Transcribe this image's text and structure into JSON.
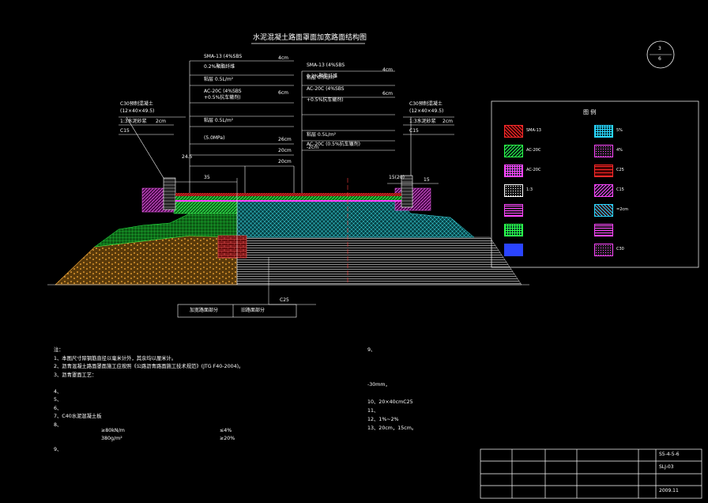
{
  "drawing": {
    "title": "水泥混凝土路面罩面加宽路面结构图",
    "sheet_top": "3",
    "sheet_bottom": "6"
  },
  "layers_center": [
    {
      "label": "SMA-13 (4%SBS",
      "thick": "4cm"
    },
    {
      "label": "0.2%聚酯纤维",
      "thick": ""
    },
    {
      "label": "粘层 0.5L/m²",
      "thick": ""
    },
    {
      "label": "AC-20C (4%SBS",
      "thick": "6cm"
    },
    {
      "label": "+0.5%抗车辙剂)",
      "thick": ""
    },
    {
      "label": "粘层 0.5L/m²",
      "thick": ""
    },
    {
      "label": "(5.0MPa)",
      "thick": "26cm"
    },
    {
      "label": "",
      "thick": "20cm"
    },
    {
      "label": "",
      "thick": "20cm"
    }
  ],
  "layers_right": [
    {
      "label": "SMA-13 (4%SBS",
      "thick": "4cm"
    },
    {
      "label": "0.2%聚酯纤维",
      "thick": ""
    },
    {
      "label": "粘层 0.5L/m²",
      "thick": ""
    },
    {
      "label": "AC-20C (4%SBS",
      "thick": "6cm"
    },
    {
      "label": "+0.5%抗车辙剂)",
      "thick": ""
    },
    {
      "label": "粘层 0.5L/m²",
      "thick": ""
    },
    {
      "label": "AC-20C (0.5%抗车辙剂)",
      "thick": ""
    },
    {
      "label": "-2cm",
      "thick": ""
    }
  ],
  "curb_left": {
    "title": "C30预制混凝土",
    "size": "(12×40×49.5)",
    "mortar": "1:3水泥砂浆",
    "mortar_t": "2cm",
    "base": "C15"
  },
  "curb_right": {
    "title": "C30预制混凝土",
    "size": "(12×40×49.5)",
    "mortar": "1:3水泥砂浆",
    "mortar_t": "2cm",
    "base": "C15"
  },
  "dims": {
    "left_dim": "35",
    "right_dim": "15",
    "left_small": "24.5",
    "right_top": "15(20)",
    "bottom_label": "C25"
  },
  "section_labels": {
    "left": "加宽路面部分",
    "right": "旧路面部分"
  },
  "legend": {
    "title": "图  例",
    "items": [
      {
        "label": "SMA-13",
        "color": "#ff2a2a",
        "pattern": "cross"
      },
      {
        "label": "5%",
        "color": "#2ad6ff",
        "pattern": "grid"
      },
      {
        "label": "AC-20C",
        "color": "#2aff4a",
        "pattern": "diag"
      },
      {
        "label": "4%",
        "color": "#ff44ff",
        "pattern": "dots"
      },
      {
        "label": "AC-20C",
        "color": "#ff44ff",
        "pattern": "grid"
      },
      {
        "label": "C25",
        "color": "#ff2a2a",
        "pattern": "brick"
      },
      {
        "label": "1:3",
        "color": "#ffffff",
        "pattern": "dots"
      },
      {
        "label": "C15",
        "color": "#ff44ff",
        "pattern": "diag"
      },
      {
        "label": "",
        "color": "#ff44ff",
        "pattern": "hlines"
      },
      {
        "label": "=2cm",
        "color": "#2ad6ff",
        "pattern": "cross"
      },
      {
        "label": "",
        "color": "#2aff4a",
        "pattern": "grid"
      },
      {
        "label": "",
        "color": "#ff44ff",
        "pattern": "hlines2"
      },
      {
        "label": "",
        "color": "#2a44ff",
        "pattern": "solid"
      },
      {
        "label": "C30",
        "color": "#ff44ff",
        "pattern": "dots2"
      }
    ]
  },
  "notes_left": [
    "注：",
    "1、本图尺寸除钢筋直径以毫米计外，其余均以厘米计。",
    "2、沥青混凝土路面罩面施工应按照《公路沥青路面施工技术规范》(JTG F40-2004)。",
    "3、沥青罩面工艺：",
    "",
    "4、",
    "5、",
    "6、",
    "7、C40水泥混凝土板",
    "8、",
    "",
    "",
    "9、"
  ],
  "notes_values": [
    {
      "label": "≥80kN/m",
      "x": "≤4%"
    },
    {
      "label": "380g/m²",
      "x": "≥20%"
    },
    {
      "label": "",
      "x": ""
    }
  ],
  "notes_right": [
    "9、",
    "",
    "",
    "",
    "-30mm，",
    "",
    "10、20×40cmC25",
    "11、",
    "12、1%~2%",
    "13、20cm，15cm。"
  ],
  "titleblock": {
    "r1": [
      "",
      "",
      "",
      "",
      "S5-4-5-6"
    ],
    "r2": [
      "",
      "",
      "",
      "",
      "SLJ-03"
    ],
    "r3": [
      "",
      "",
      "",
      "",
      ""
    ],
    "r4": [
      "",
      "",
      "",
      "",
      "2009.11"
    ]
  }
}
